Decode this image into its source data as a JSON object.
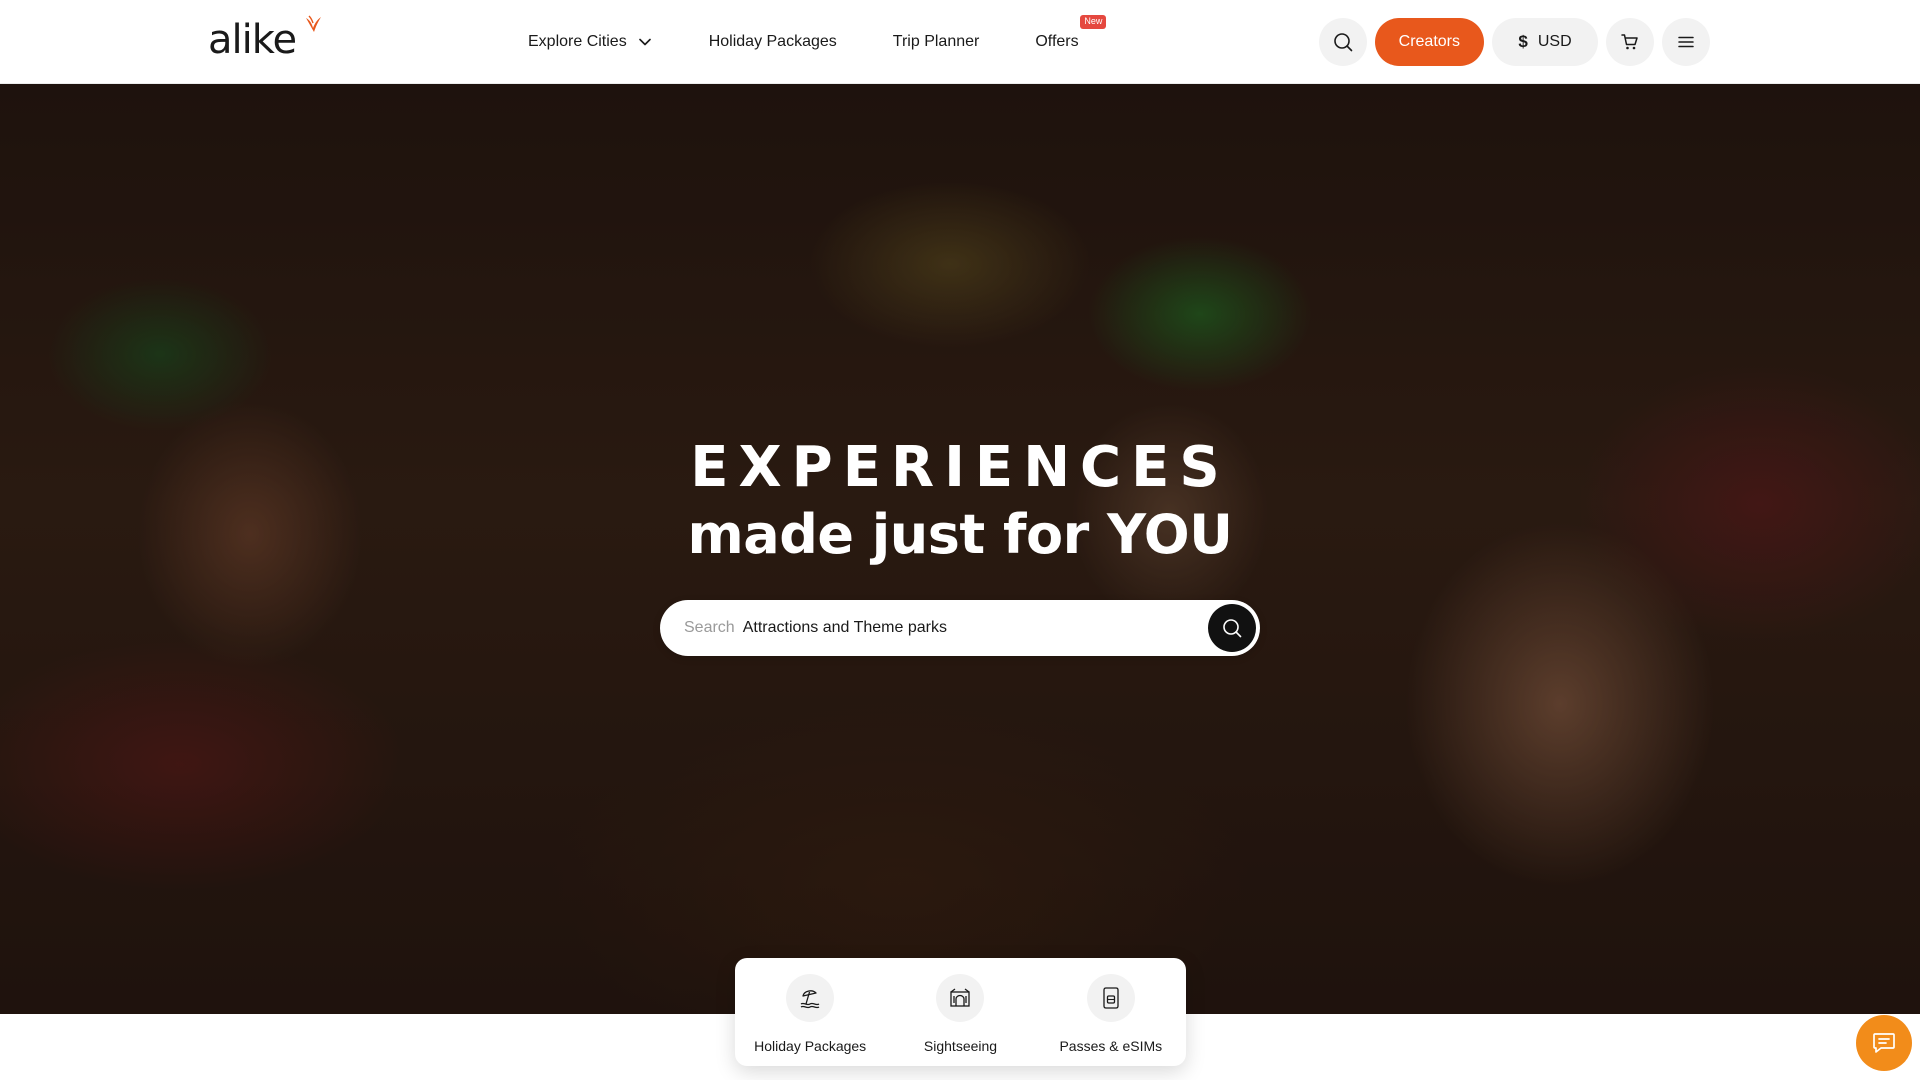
{
  "brand": {
    "name": "alike",
    "accent_color": "#e8581c"
  },
  "nav": {
    "explore_label": "Explore Cities",
    "holiday_label": "Holiday Packages",
    "trip_label": "Trip Planner",
    "offers_label": "Offers",
    "offers_badge": "New"
  },
  "header": {
    "search_icon": "search-icon",
    "creators_label": "Creators",
    "currency_symbol": "$",
    "currency_label": "USD",
    "cart_icon": "cart-icon",
    "menu_icon": "menu-icon"
  },
  "hero": {
    "title": "EXPERIENCES",
    "subtitle": "made just for YOU",
    "search": {
      "label": "Search",
      "value": "Attractions and Theme parks",
      "button_icon": "search-icon"
    }
  },
  "categories": [
    {
      "label": "Holiday Packages",
      "icon": "beach-umbrella-icon"
    },
    {
      "label": "Sightseeing",
      "icon": "landmark-icon"
    },
    {
      "label": "Passes & eSIMs",
      "icon": "sim-card-icon"
    }
  ],
  "chat": {
    "icon": "chat-icon",
    "color": "#f28c1a"
  }
}
